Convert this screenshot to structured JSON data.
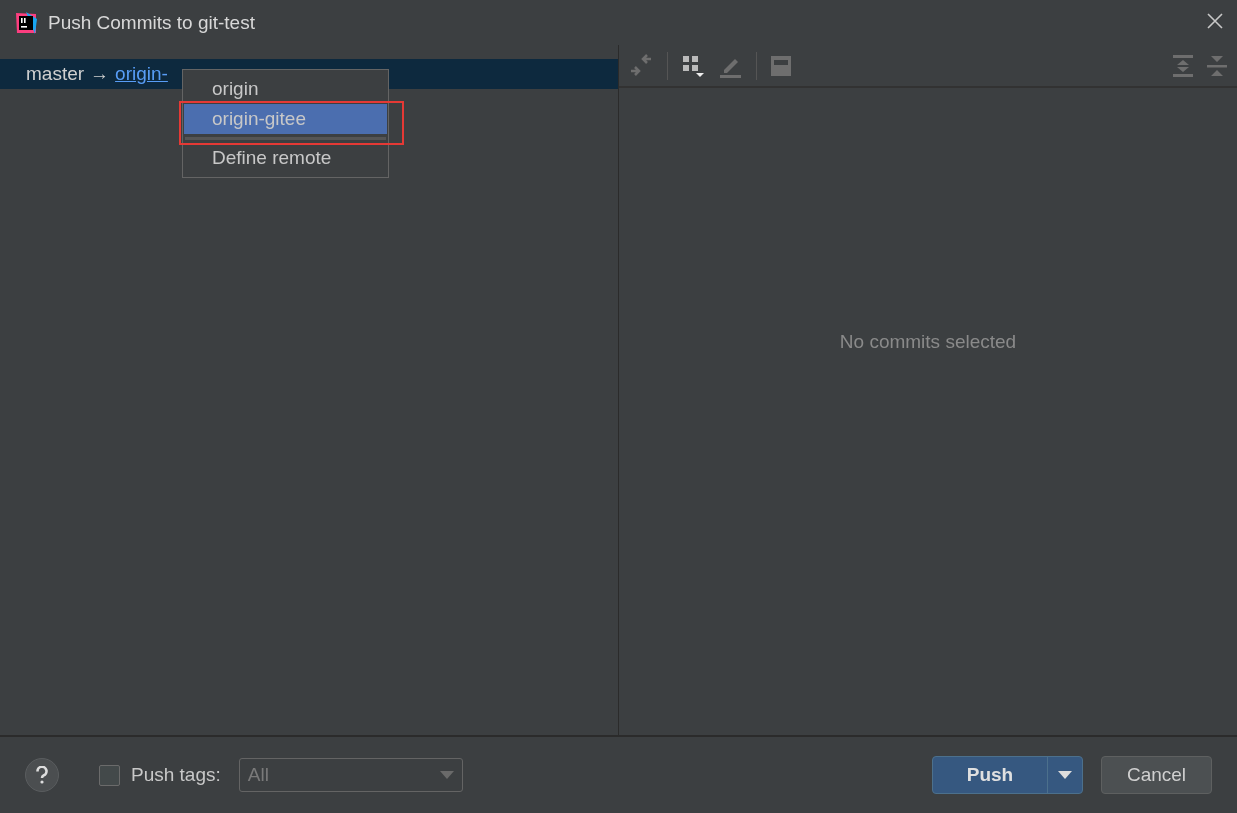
{
  "window": {
    "title": "Push Commits to git-test"
  },
  "branch_row": {
    "source": "master",
    "arrow": "→",
    "target": "origin-",
    "selected": true
  },
  "remote_menu": {
    "items": [
      {
        "kind": "item",
        "label": "origin",
        "selected": false,
        "annotated": false
      },
      {
        "kind": "item",
        "label": "origin-gitee",
        "selected": true,
        "annotated": true
      },
      {
        "kind": "separator"
      },
      {
        "kind": "item",
        "label": "Define remote",
        "selected": false,
        "annotated": false
      }
    ]
  },
  "details": {
    "empty_text": "No commits selected"
  },
  "footer": {
    "push_tags": {
      "label": "Push tags:",
      "checked": false
    },
    "tags_dropdown": {
      "value": "All",
      "disabled": true
    },
    "buttons": [
      {
        "kind": "primary",
        "label": "Push"
      },
      {
        "kind": "secondary",
        "label": "Cancel"
      }
    ]
  }
}
